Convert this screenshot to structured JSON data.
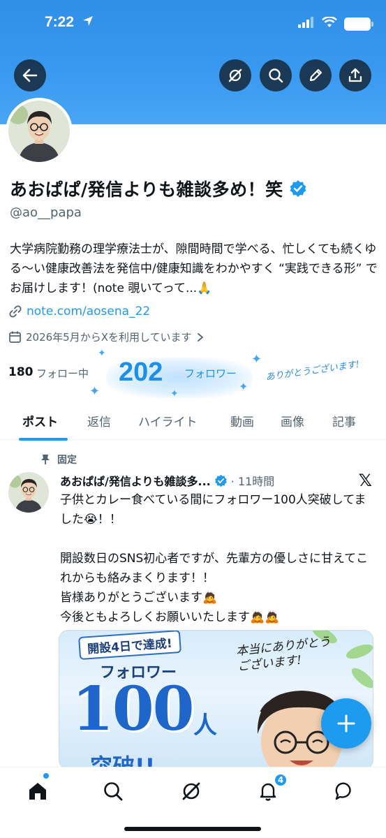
{
  "status_bar": {
    "time": "7:22"
  },
  "header": {
    "buttons": [
      "back-icon",
      "grok-icon",
      "search-icon",
      "edit-icon",
      "share-icon"
    ]
  },
  "profile": {
    "display_name": "あおぱぱ/発信よりも雑談多め！笑",
    "handle": "@ao__papa",
    "bio": "大学病院勤務の理学療法士が、隙間時間で学べる、忙しくても続くゆる〜い健康改善法を発信中/健康知識をわかやすく “実践できる形” でお届けします！(note 覗いてって...🙏",
    "link": "note.com/aosena_22",
    "joined": "2026年5月からXを利用しています",
    "following_count": "180",
    "following_label": "フォロー中",
    "followers_count": "202",
    "followers_label": "フォロワー",
    "thanks_text": "ありがとうございます!"
  },
  "tabs": [
    {
      "label": "ポスト",
      "active": true
    },
    {
      "label": "返信",
      "active": false
    },
    {
      "label": "ハイライト",
      "active": false
    },
    {
      "label": "動画",
      "active": false
    },
    {
      "label": "画像",
      "active": false
    },
    {
      "label": "記事",
      "active": false
    }
  ],
  "post": {
    "pinned_label": "固定",
    "author_name": "あおぱぱ/発信よりも雑談多...",
    "time": "· 11時間",
    "text": "子供とカレー食べている間にフォロワー100人突破してました😭！！\n\n開設数日のSNS初心者ですが、先輩方の優しさに甘えてこれからも絡みまくります！！\n皆様ありがとうございます🙇\n今後ともよろしくお願いいたします🙇🙇",
    "image": {
      "banner": "開設4日で達成!",
      "follower_label": "フォロワー",
      "big_number": "100",
      "nin": "人",
      "toppa": "突破!!",
      "script": "本当にありがとう\nございます!"
    }
  },
  "bottom_nav": {
    "items": [
      "home-icon",
      "search-icon",
      "grok-icon",
      "notifications-icon",
      "messages-icon"
    ],
    "notification_badge": "4"
  },
  "colors": {
    "accent": "#1d9bf0",
    "banner": "#3a9af0",
    "text": "#0f1419",
    "secondary": "#536471"
  }
}
